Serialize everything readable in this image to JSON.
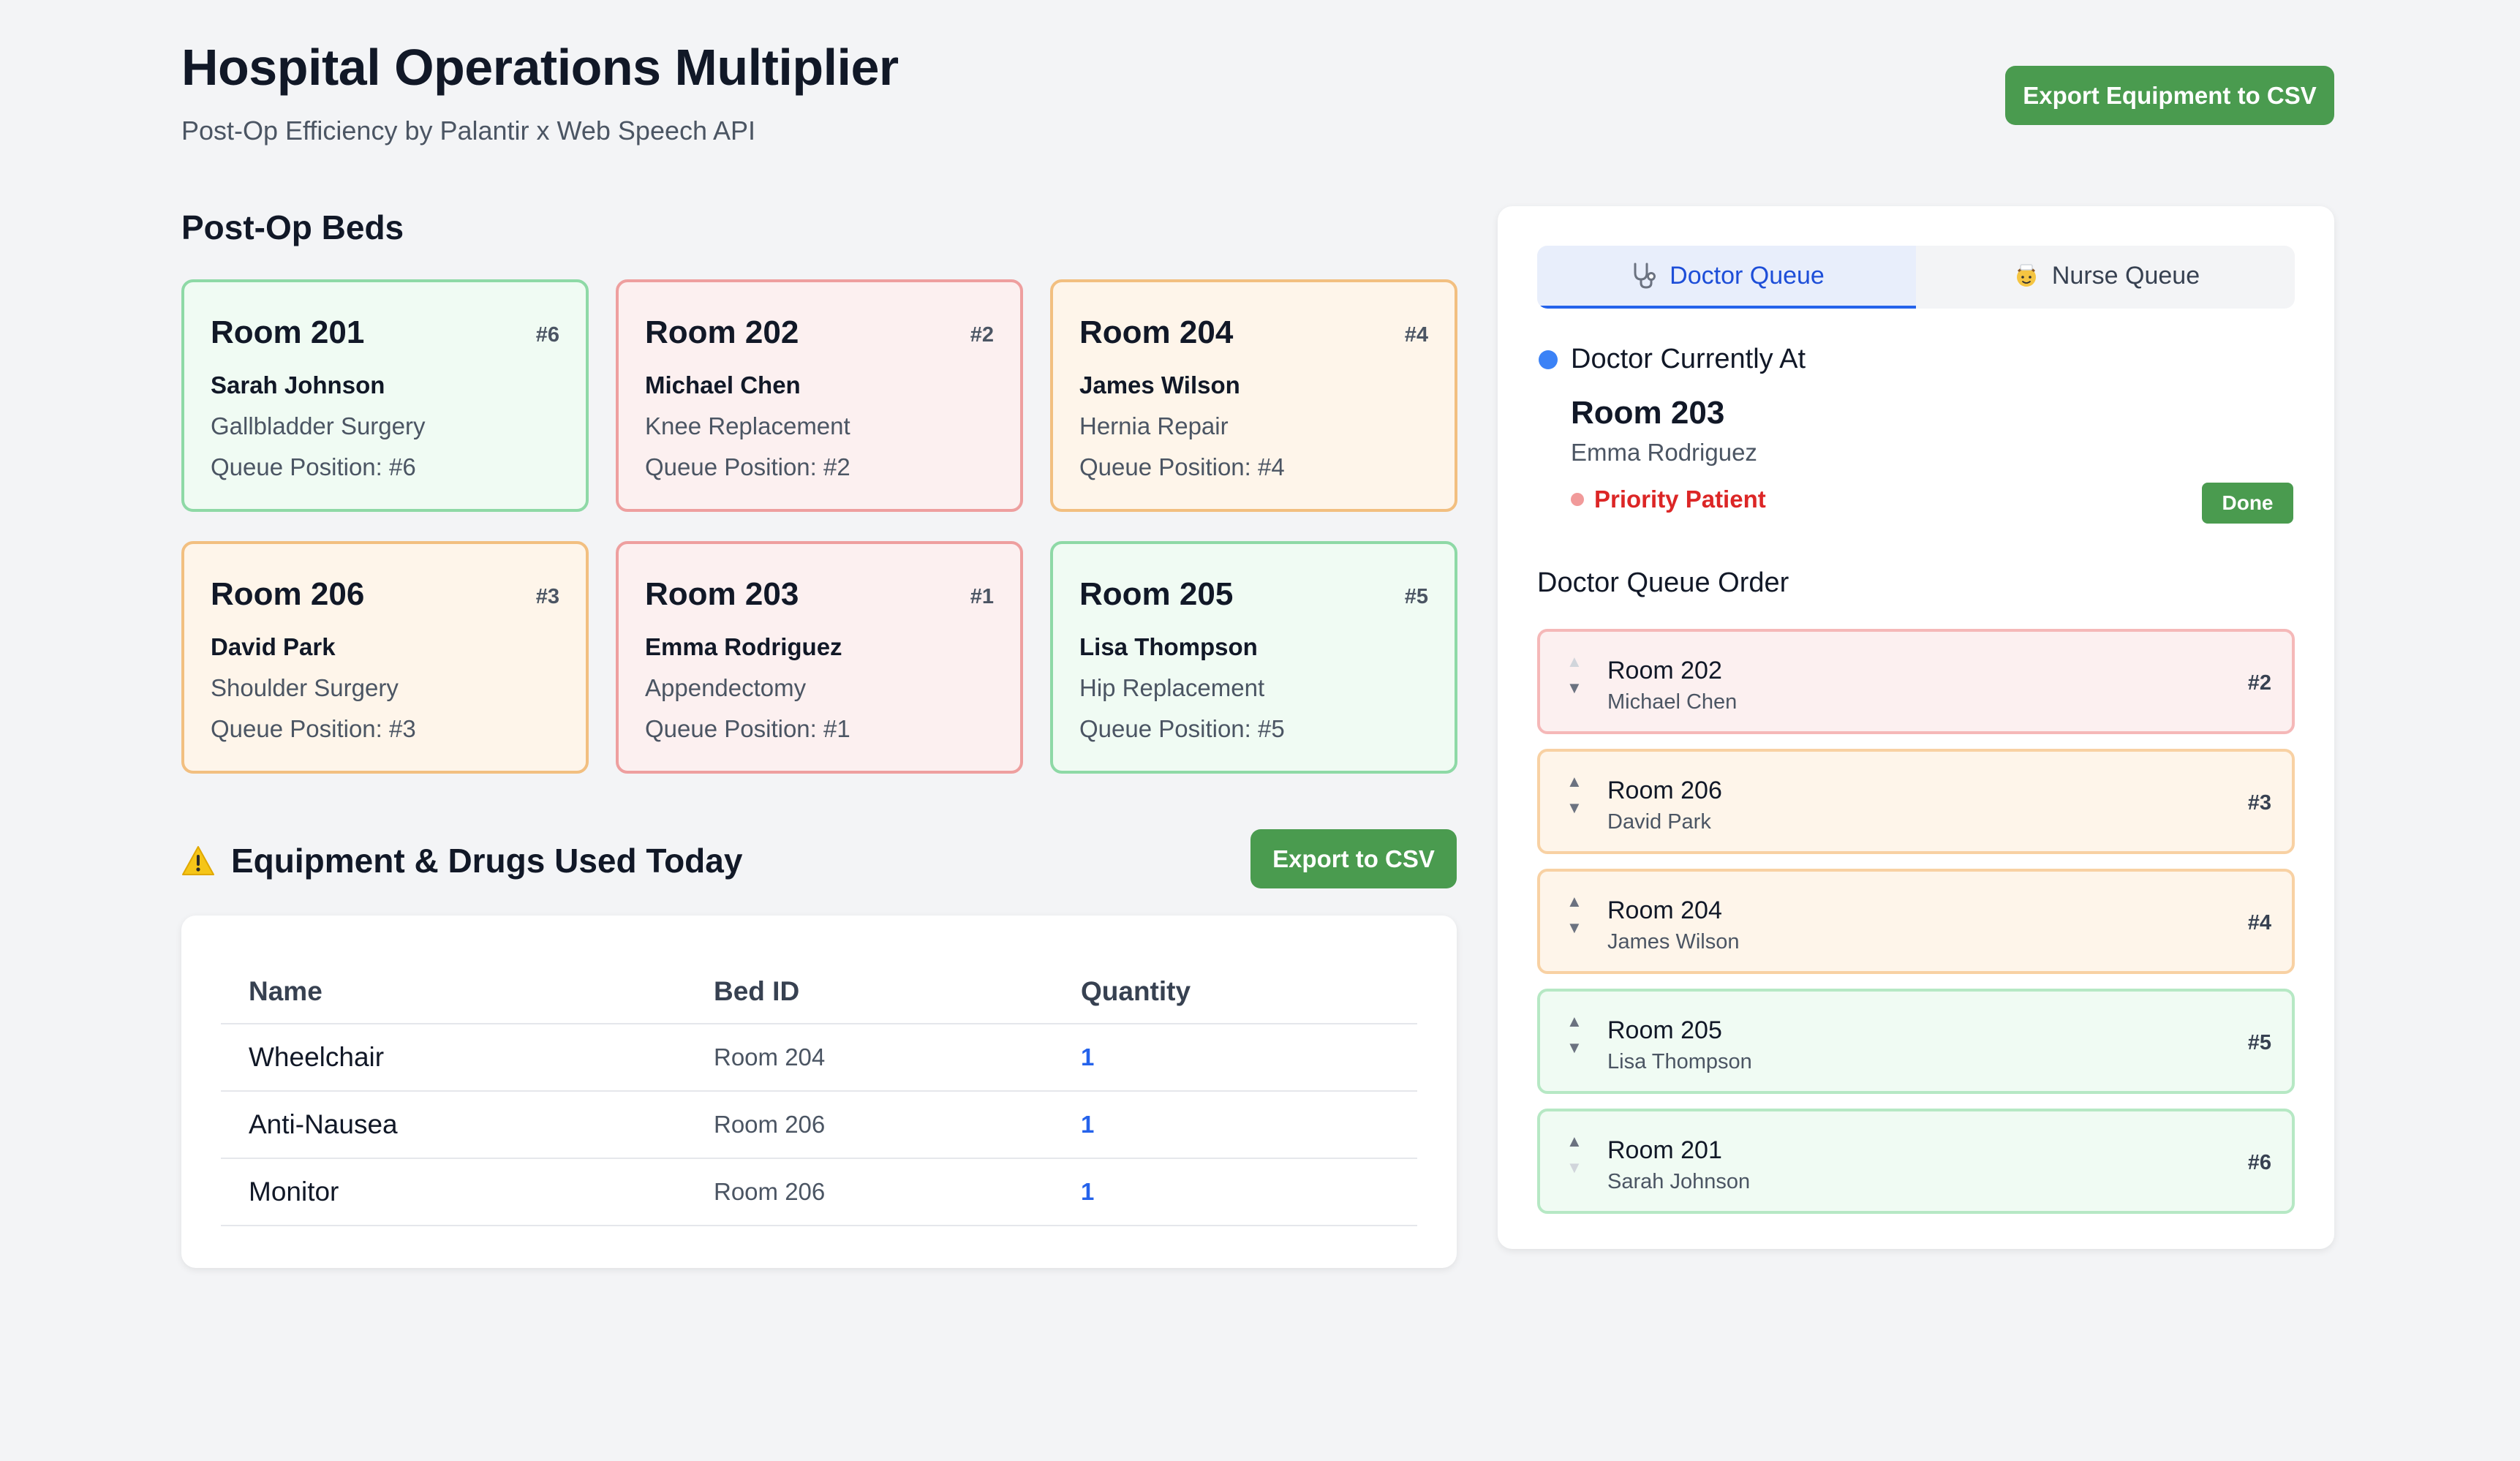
{
  "header": {
    "title": "Hospital Operations Multiplier",
    "subtitle": "Post-Op Efficiency by Palantir x Web Speech API",
    "export_equipment_label": "Export Equipment to CSV"
  },
  "beds": {
    "title": "Post-Op Beds",
    "queue_prefix": "Queue Position: ",
    "items": [
      {
        "room": "Room 201",
        "badge": "#6",
        "patient": "Sarah Johnson",
        "procedure": "Gallbladder Surgery",
        "queue": "Queue Position: #6",
        "status": "green"
      },
      {
        "room": "Room 202",
        "badge": "#2",
        "patient": "Michael Chen",
        "procedure": "Knee Replacement",
        "queue": "Queue Position: #2",
        "status": "red"
      },
      {
        "room": "Room 204",
        "badge": "#4",
        "patient": "James Wilson",
        "procedure": "Hernia Repair",
        "queue": "Queue Position: #4",
        "status": "orange"
      },
      {
        "room": "Room 206",
        "badge": "#3",
        "patient": "David Park",
        "procedure": "Shoulder Surgery",
        "queue": "Queue Position: #3",
        "status": "orange"
      },
      {
        "room": "Room 203",
        "badge": "#1",
        "patient": "Emma Rodriguez",
        "procedure": "Appendectomy",
        "queue": "Queue Position: #1",
        "status": "red"
      },
      {
        "room": "Room 205",
        "badge": "#5",
        "patient": "Lisa Thompson",
        "procedure": "Hip Replacement",
        "queue": "Queue Position: #5",
        "status": "green"
      }
    ]
  },
  "equipment": {
    "title": "Equipment & Drugs Used Today",
    "export_label": "Export to CSV",
    "columns": [
      "Name",
      "Bed ID",
      "Quantity"
    ],
    "rows": [
      {
        "name": "Wheelchair",
        "bed": "Room 204",
        "qty": "1"
      },
      {
        "name": "Anti-Nausea",
        "bed": "Room 206",
        "qty": "1"
      },
      {
        "name": "Monitor",
        "bed": "Room 206",
        "qty": "1"
      }
    ]
  },
  "queue_panel": {
    "tabs": [
      {
        "label": "Doctor Queue",
        "icon": "stethoscope-icon",
        "active": true
      },
      {
        "label": "Nurse Queue",
        "icon": "nurse-icon",
        "active": false
      }
    ],
    "current": {
      "label": "Doctor Currently At",
      "room": "Room 203",
      "patient": "Emma Rodriguez",
      "priority_label": "Priority Patient",
      "done_label": "Done"
    },
    "order_title": "Doctor Queue Order",
    "order": [
      {
        "room": "Room 202",
        "patient": "Michael Chen",
        "badge": "#2",
        "status": "red"
      },
      {
        "room": "Room 206",
        "patient": "David Park",
        "badge": "#3",
        "status": "orange"
      },
      {
        "room": "Room 204",
        "patient": "James Wilson",
        "badge": "#4",
        "status": "orange"
      },
      {
        "room": "Room 205",
        "patient": "Lisa Thompson",
        "badge": "#5",
        "status": "green"
      },
      {
        "room": "Room 201",
        "patient": "Sarah Johnson",
        "badge": "#6",
        "status": "green"
      }
    ]
  },
  "colors": {
    "accent_green": "#4a9b4f",
    "accent_blue": "#2563eb",
    "priority_red": "#dc2626"
  }
}
